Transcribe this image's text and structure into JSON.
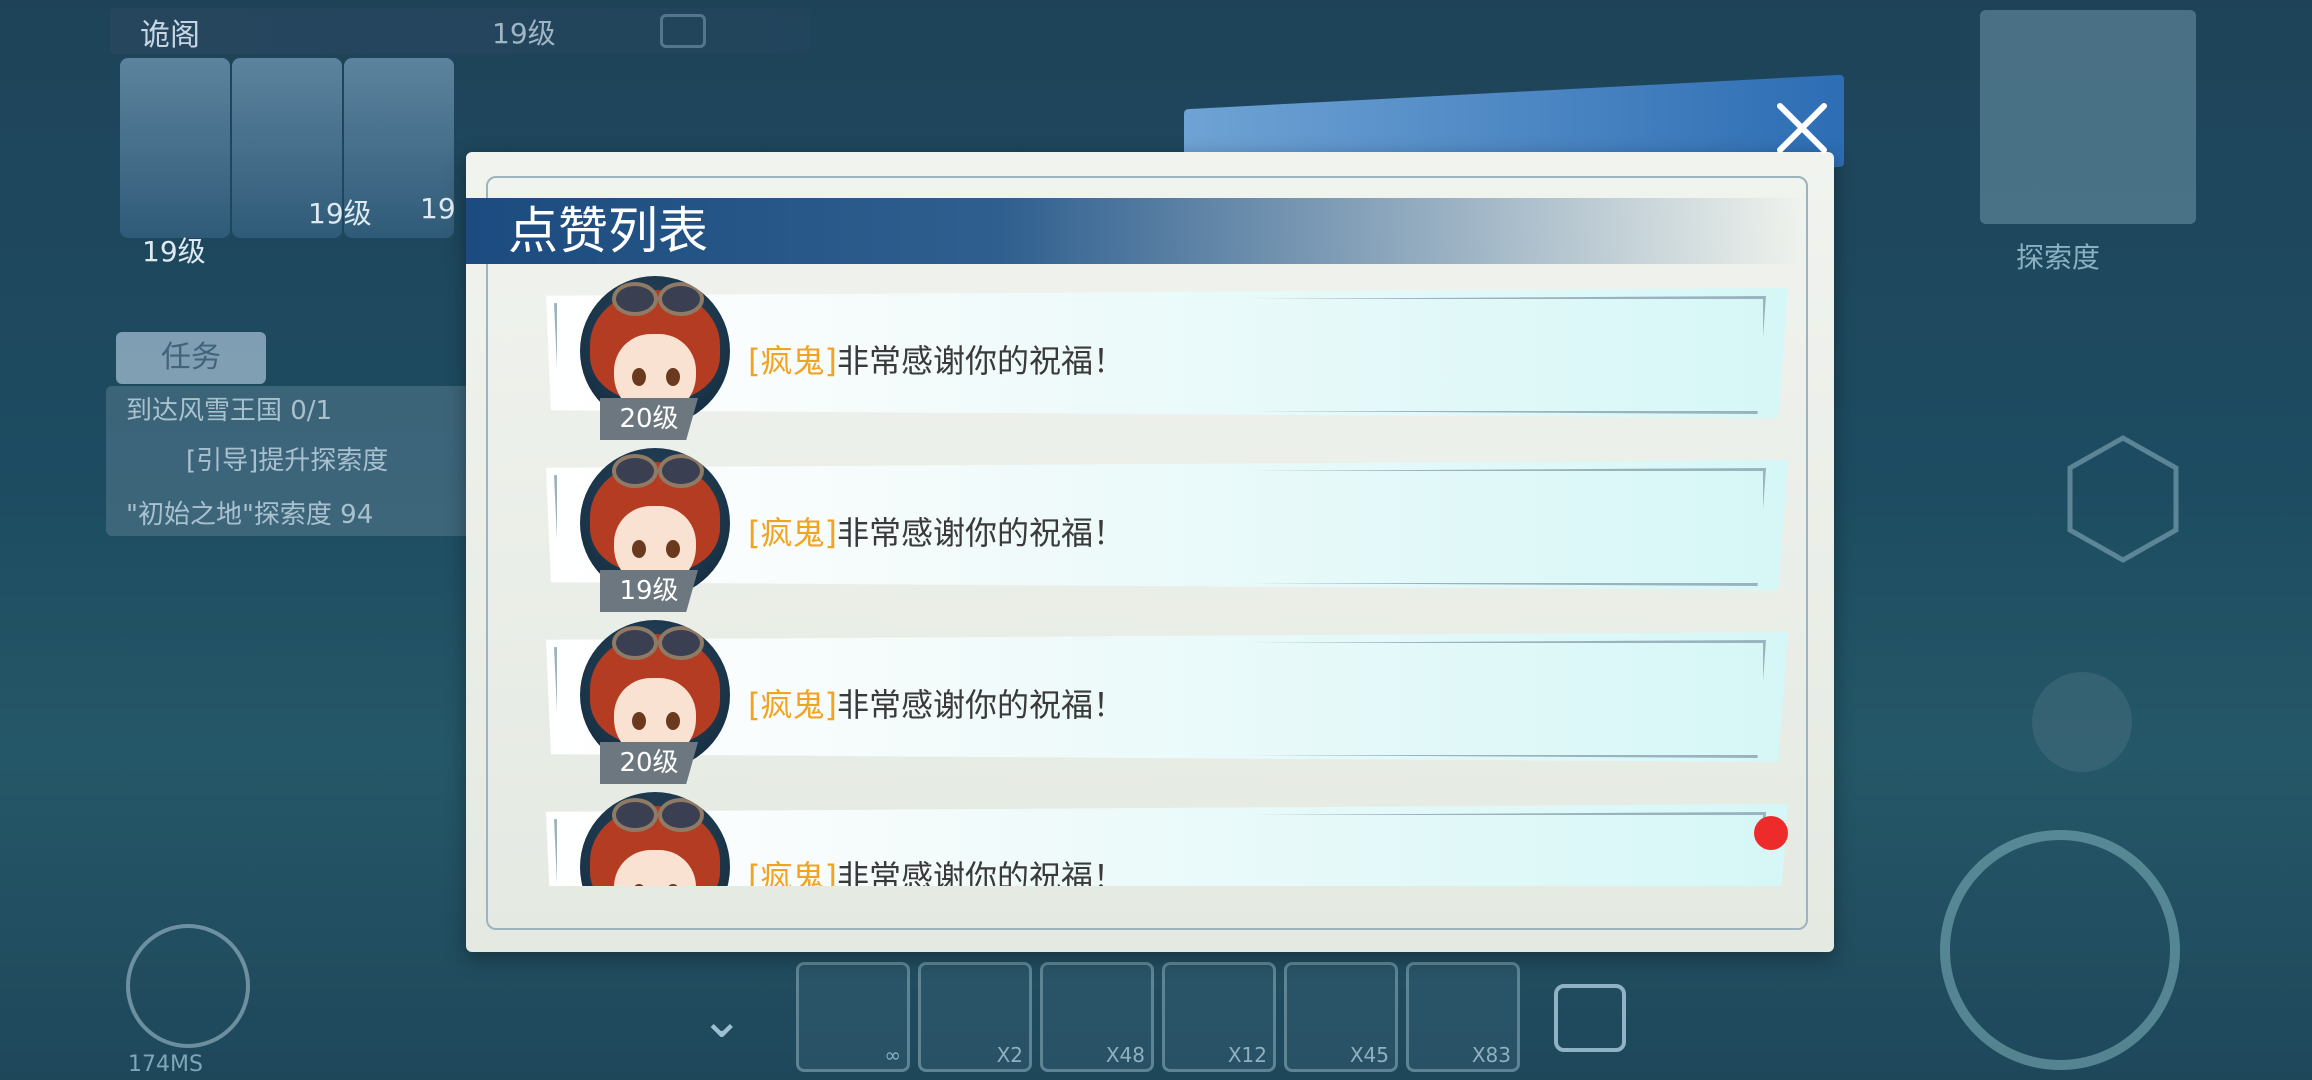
{
  "hud": {
    "player_name": "诡阁",
    "player_level": "19级",
    "party_levels": [
      "19级",
      "19级",
      "19"
    ],
    "quest_tab": "任务",
    "quest_lines": [
      "到达风雪王国 0/1",
      "[引导]提升探索度",
      "\"初始之地\"探索度 94"
    ],
    "explore_label": "探索度",
    "ping": "174MS",
    "slot_counts": [
      "∞",
      "X2",
      "X48",
      "X12",
      "X45",
      "X83"
    ]
  },
  "dialog": {
    "title": "点赞列表",
    "close_icon": "close-icon"
  },
  "likes": [
    {
      "name": "[疯鬼]",
      "message": "非常感谢你的祝福！",
      "level": "20级",
      "unread": false
    },
    {
      "name": "[疯鬼]",
      "message": "非常感谢你的祝福！",
      "level": "19级",
      "unread": false
    },
    {
      "name": "[疯鬼]",
      "message": "非常感谢你的祝福！",
      "level": "20级",
      "unread": false
    },
    {
      "name": "[疯鬼]",
      "message": "非常感谢你的祝福！",
      "level": "",
      "unread": true
    }
  ],
  "colors": {
    "name_accent": "#f2a320",
    "title_bar": "#1c4b7f",
    "badge": "#6d7780",
    "unread_dot": "#ee2b2b"
  }
}
